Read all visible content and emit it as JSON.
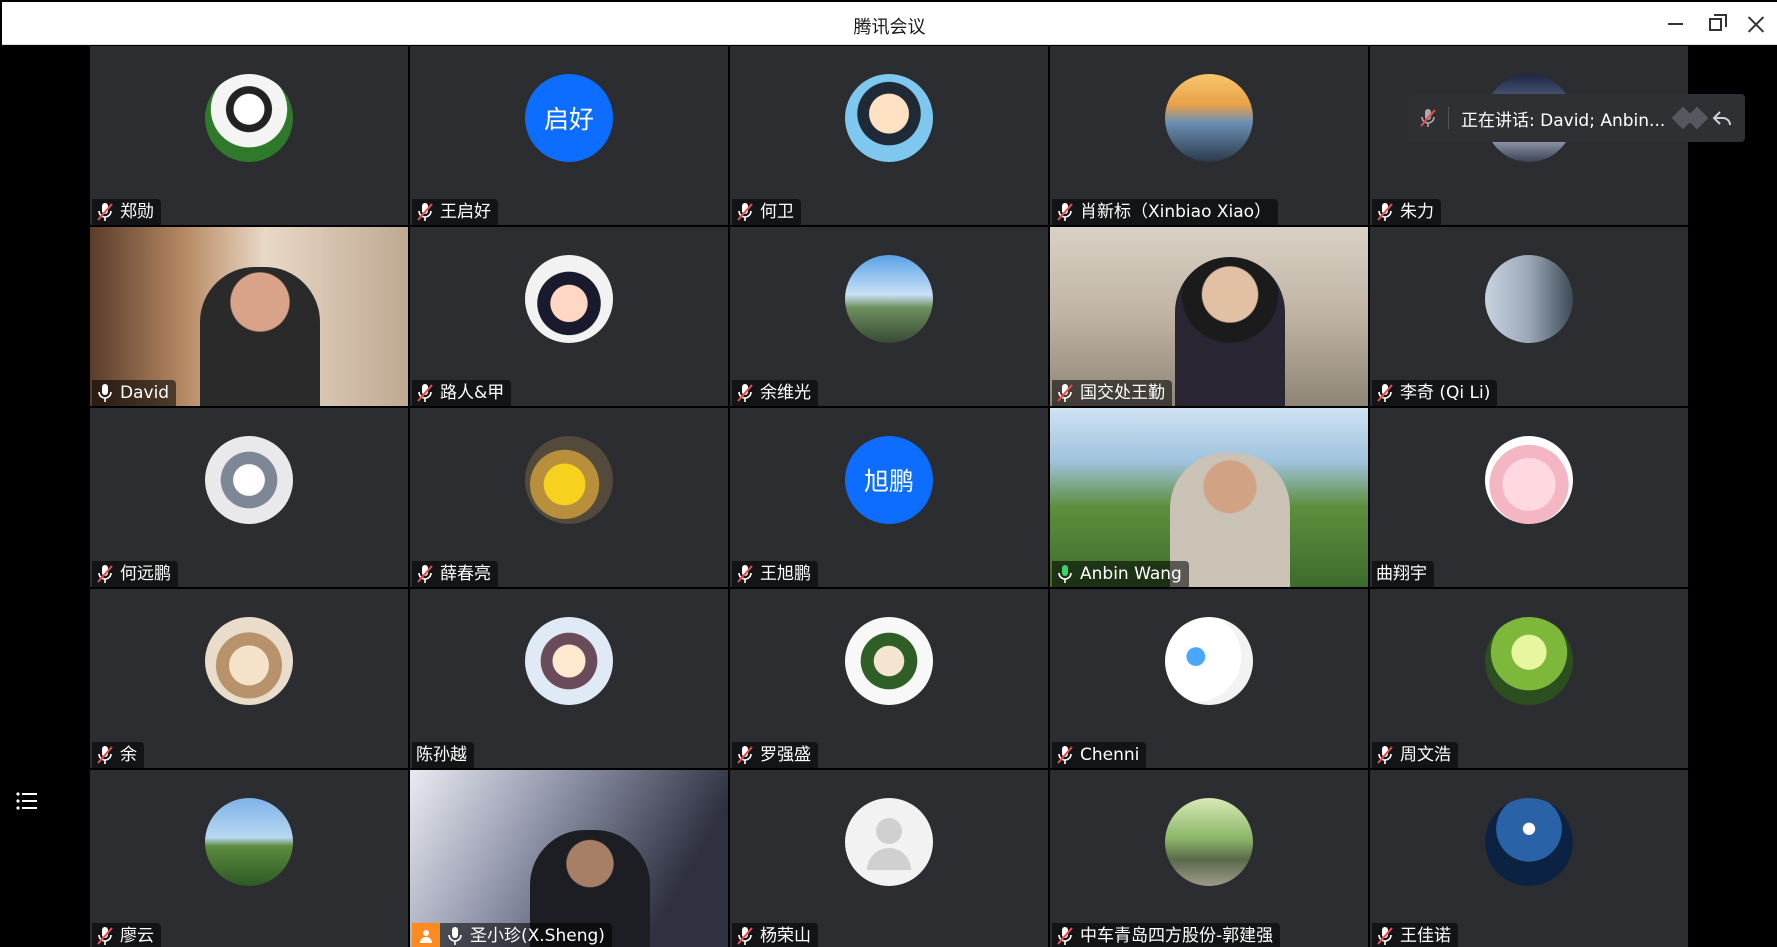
{
  "window": {
    "title": "腾讯会议"
  },
  "speaking": {
    "text": "正在讲话: David; Anbin..."
  },
  "colors": {
    "accent": "#0c6dff",
    "active_border": "#2fbf60",
    "tile_bg": "#2b2d30",
    "share_badge": "#ff8a1f"
  },
  "tiles": [
    {
      "name": "郑勋",
      "mic": "muted",
      "kind": "avatar",
      "avatar": "panda"
    },
    {
      "name": "王启好",
      "mic": "muted",
      "kind": "text",
      "avatar_text": "启好"
    },
    {
      "name": "何卫",
      "mic": "muted",
      "kind": "avatar",
      "avatar": "cartoon-boy"
    },
    {
      "name": "肖新标（Xinbiao Xiao）",
      "mic": "muted",
      "kind": "avatar",
      "avatar": "sunset-river"
    },
    {
      "name": "朱力",
      "mic": "muted",
      "kind": "avatar",
      "avatar": "night-sky"
    },
    {
      "name": "David",
      "mic": "on",
      "kind": "video",
      "active": true
    },
    {
      "name": "路人&甲",
      "mic": "muted",
      "kind": "avatar",
      "avatar": "anime-girl"
    },
    {
      "name": "余维光",
      "mic": "muted",
      "kind": "avatar",
      "avatar": "mountains"
    },
    {
      "name": "国交处王勤",
      "mic": "muted",
      "kind": "video"
    },
    {
      "name": "李奇 (Qi Li)",
      "mic": "muted",
      "kind": "avatar",
      "avatar": "city-portrait"
    },
    {
      "name": "何远鹏",
      "mic": "muted",
      "kind": "avatar",
      "avatar": "cat"
    },
    {
      "name": "薛春亮",
      "mic": "muted",
      "kind": "avatar",
      "avatar": "duck-sticker"
    },
    {
      "name": "王旭鹏",
      "mic": "muted",
      "kind": "text",
      "avatar_text": "旭鹏"
    },
    {
      "name": "Anbin Wang",
      "mic": "speaking",
      "kind": "video"
    },
    {
      "name": "曲翔宇",
      "mic": "none",
      "kind": "avatar",
      "avatar": "pink-blob"
    },
    {
      "name": "余",
      "mic": "muted",
      "kind": "avatar",
      "avatar": "cat-photo"
    },
    {
      "name": "陈孙越",
      "mic": "none",
      "kind": "avatar",
      "avatar": "anime-girl-2"
    },
    {
      "name": "罗强盛",
      "mic": "muted",
      "kind": "avatar",
      "avatar": "soldier-cartoon"
    },
    {
      "name": "Chenni",
      "mic": "muted",
      "kind": "avatar",
      "avatar": "white-cat"
    },
    {
      "name": "周文浩",
      "mic": "muted",
      "kind": "avatar",
      "avatar": "green-leaves"
    },
    {
      "name": "廖云",
      "mic": "muted",
      "kind": "avatar",
      "avatar": "grassland"
    },
    {
      "name": "圣小珍(X.Sheng)",
      "mic": "on",
      "kind": "video",
      "sharing": true
    },
    {
      "name": "杨荣山",
      "mic": "muted",
      "kind": "avatar",
      "avatar": "default-user"
    },
    {
      "name": "中车青岛四方股份-郭建强",
      "mic": "muted",
      "kind": "avatar",
      "avatar": "park-walk"
    },
    {
      "name": "王佳诺",
      "mic": "muted",
      "kind": "avatar",
      "avatar": "moon-sea"
    }
  ]
}
